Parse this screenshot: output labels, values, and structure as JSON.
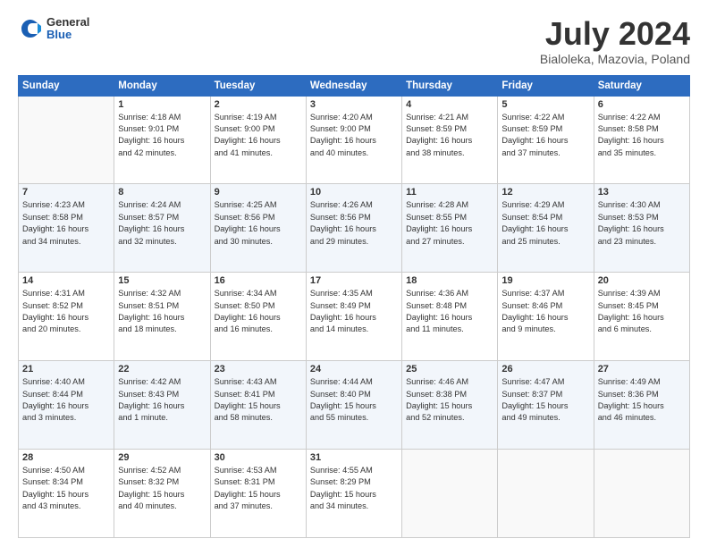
{
  "logo": {
    "general": "General",
    "blue": "Blue"
  },
  "title": "July 2024",
  "location": "Bialoleka, Mazovia, Poland",
  "days_header": [
    "Sunday",
    "Monday",
    "Tuesday",
    "Wednesday",
    "Thursday",
    "Friday",
    "Saturday"
  ],
  "weeks": [
    [
      {
        "day": "",
        "info": ""
      },
      {
        "day": "1",
        "info": "Sunrise: 4:18 AM\nSunset: 9:01 PM\nDaylight: 16 hours\nand 42 minutes."
      },
      {
        "day": "2",
        "info": "Sunrise: 4:19 AM\nSunset: 9:00 PM\nDaylight: 16 hours\nand 41 minutes."
      },
      {
        "day": "3",
        "info": "Sunrise: 4:20 AM\nSunset: 9:00 PM\nDaylight: 16 hours\nand 40 minutes."
      },
      {
        "day": "4",
        "info": "Sunrise: 4:21 AM\nSunset: 8:59 PM\nDaylight: 16 hours\nand 38 minutes."
      },
      {
        "day": "5",
        "info": "Sunrise: 4:22 AM\nSunset: 8:59 PM\nDaylight: 16 hours\nand 37 minutes."
      },
      {
        "day": "6",
        "info": "Sunrise: 4:22 AM\nSunset: 8:58 PM\nDaylight: 16 hours\nand 35 minutes."
      }
    ],
    [
      {
        "day": "7",
        "info": "Sunrise: 4:23 AM\nSunset: 8:58 PM\nDaylight: 16 hours\nand 34 minutes."
      },
      {
        "day": "8",
        "info": "Sunrise: 4:24 AM\nSunset: 8:57 PM\nDaylight: 16 hours\nand 32 minutes."
      },
      {
        "day": "9",
        "info": "Sunrise: 4:25 AM\nSunset: 8:56 PM\nDaylight: 16 hours\nand 30 minutes."
      },
      {
        "day": "10",
        "info": "Sunrise: 4:26 AM\nSunset: 8:56 PM\nDaylight: 16 hours\nand 29 minutes."
      },
      {
        "day": "11",
        "info": "Sunrise: 4:28 AM\nSunset: 8:55 PM\nDaylight: 16 hours\nand 27 minutes."
      },
      {
        "day": "12",
        "info": "Sunrise: 4:29 AM\nSunset: 8:54 PM\nDaylight: 16 hours\nand 25 minutes."
      },
      {
        "day": "13",
        "info": "Sunrise: 4:30 AM\nSunset: 8:53 PM\nDaylight: 16 hours\nand 23 minutes."
      }
    ],
    [
      {
        "day": "14",
        "info": "Sunrise: 4:31 AM\nSunset: 8:52 PM\nDaylight: 16 hours\nand 20 minutes."
      },
      {
        "day": "15",
        "info": "Sunrise: 4:32 AM\nSunset: 8:51 PM\nDaylight: 16 hours\nand 18 minutes."
      },
      {
        "day": "16",
        "info": "Sunrise: 4:34 AM\nSunset: 8:50 PM\nDaylight: 16 hours\nand 16 minutes."
      },
      {
        "day": "17",
        "info": "Sunrise: 4:35 AM\nSunset: 8:49 PM\nDaylight: 16 hours\nand 14 minutes."
      },
      {
        "day": "18",
        "info": "Sunrise: 4:36 AM\nSunset: 8:48 PM\nDaylight: 16 hours\nand 11 minutes."
      },
      {
        "day": "19",
        "info": "Sunrise: 4:37 AM\nSunset: 8:46 PM\nDaylight: 16 hours\nand 9 minutes."
      },
      {
        "day": "20",
        "info": "Sunrise: 4:39 AM\nSunset: 8:45 PM\nDaylight: 16 hours\nand 6 minutes."
      }
    ],
    [
      {
        "day": "21",
        "info": "Sunrise: 4:40 AM\nSunset: 8:44 PM\nDaylight: 16 hours\nand 3 minutes."
      },
      {
        "day": "22",
        "info": "Sunrise: 4:42 AM\nSunset: 8:43 PM\nDaylight: 16 hours\nand 1 minute."
      },
      {
        "day": "23",
        "info": "Sunrise: 4:43 AM\nSunset: 8:41 PM\nDaylight: 15 hours\nand 58 minutes."
      },
      {
        "day": "24",
        "info": "Sunrise: 4:44 AM\nSunset: 8:40 PM\nDaylight: 15 hours\nand 55 minutes."
      },
      {
        "day": "25",
        "info": "Sunrise: 4:46 AM\nSunset: 8:38 PM\nDaylight: 15 hours\nand 52 minutes."
      },
      {
        "day": "26",
        "info": "Sunrise: 4:47 AM\nSunset: 8:37 PM\nDaylight: 15 hours\nand 49 minutes."
      },
      {
        "day": "27",
        "info": "Sunrise: 4:49 AM\nSunset: 8:36 PM\nDaylight: 15 hours\nand 46 minutes."
      }
    ],
    [
      {
        "day": "28",
        "info": "Sunrise: 4:50 AM\nSunset: 8:34 PM\nDaylight: 15 hours\nand 43 minutes."
      },
      {
        "day": "29",
        "info": "Sunrise: 4:52 AM\nSunset: 8:32 PM\nDaylight: 15 hours\nand 40 minutes."
      },
      {
        "day": "30",
        "info": "Sunrise: 4:53 AM\nSunset: 8:31 PM\nDaylight: 15 hours\nand 37 minutes."
      },
      {
        "day": "31",
        "info": "Sunrise: 4:55 AM\nSunset: 8:29 PM\nDaylight: 15 hours\nand 34 minutes."
      },
      {
        "day": "",
        "info": ""
      },
      {
        "day": "",
        "info": ""
      },
      {
        "day": "",
        "info": ""
      }
    ]
  ]
}
